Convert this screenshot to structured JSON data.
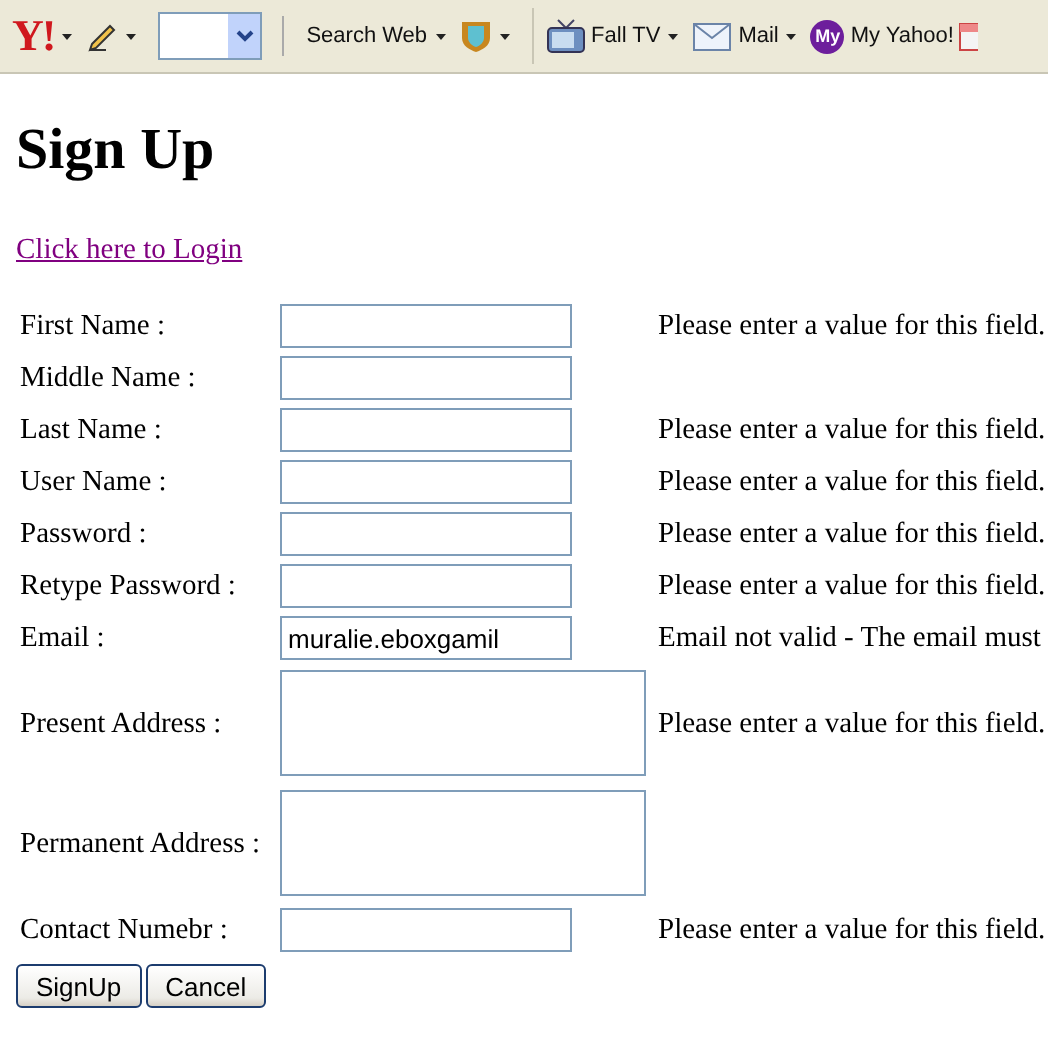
{
  "toolbar": {
    "items": [
      {
        "kind": "logo",
        "label": "Y!",
        "menu": true
      },
      {
        "kind": "pencil",
        "menu": true
      },
      {
        "kind": "combo"
      },
      {
        "kind": "grip"
      },
      {
        "kind": "button",
        "label": "Search Web",
        "menu": true
      },
      {
        "kind": "shield",
        "menu": true
      },
      {
        "kind": "separator"
      },
      {
        "kind": "tv",
        "label": "Fall TV",
        "menu": true
      },
      {
        "kind": "mail",
        "label": "Mail",
        "menu": true
      },
      {
        "kind": "my",
        "badge": "My",
        "label": "My Yahoo!"
      },
      {
        "kind": "calendar"
      }
    ]
  },
  "page": {
    "title": "Sign Up",
    "login_link": "Click here to Login",
    "fields": [
      {
        "label": "First Name :",
        "kind": "text",
        "message": "Please enter a value for this field."
      },
      {
        "label": "Middle Name :",
        "kind": "text"
      },
      {
        "label": "Last Name :",
        "kind": "text",
        "message": "Please enter a value for this field."
      },
      {
        "label": "User Name :",
        "kind": "text",
        "message": "Please enter a value for this field."
      },
      {
        "label": "Password :",
        "kind": "text",
        "message": "Please enter a value for this field."
      },
      {
        "label": "Retype Password :",
        "kind": "text",
        "message": "Please enter a value for this field."
      },
      {
        "label": "Email :",
        "kind": "text",
        "value": "muralie.eboxgamil",
        "message": "Email not valid - The email must"
      },
      {
        "label": "Present Address :",
        "kind": "textarea",
        "message": "Please enter a value for this field."
      },
      {
        "label": "Permanent Address :",
        "kind": "textarea"
      },
      {
        "label": "Contact Numebr :",
        "kind": "text",
        "message": "Please enter a value for this field."
      }
    ],
    "buttons": [
      "SignUp",
      "Cancel"
    ]
  }
}
